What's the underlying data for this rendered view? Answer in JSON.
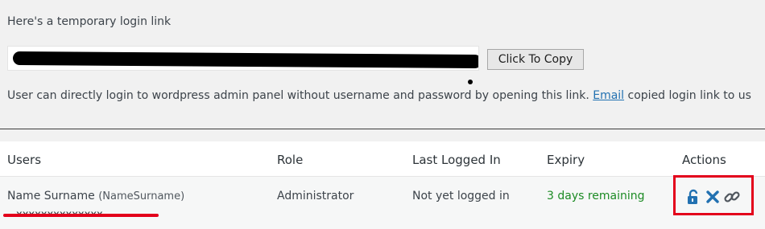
{
  "intro_text": "Here's a temporary login link",
  "link_input": {
    "value": ""
  },
  "copy_button_label": "Click To Copy",
  "info": {
    "before": "User can directly login to wordpress admin panel without username and password by opening this link. ",
    "link": "Email",
    "after": " copied login link to us"
  },
  "table": {
    "headers": {
      "users": "Users",
      "role": "Role",
      "last_logged_in": "Last Logged In",
      "expiry": "Expiry",
      "actions": "Actions"
    },
    "rows": [
      {
        "name": "Name Surname",
        "username": "(NameSurname)",
        "role": "Administrator",
        "last_logged_in": "Not yet logged in",
        "expiry": "3 days remaining"
      }
    ]
  },
  "icons": {
    "unlock": "unlock-icon",
    "delete": "close-icon",
    "copy_link": "link-icon"
  },
  "colors": {
    "link": "#2271b1",
    "expiry_green": "#1c8b24",
    "icon_blue": "#2271b1",
    "annotation_red": "#e3001b"
  }
}
